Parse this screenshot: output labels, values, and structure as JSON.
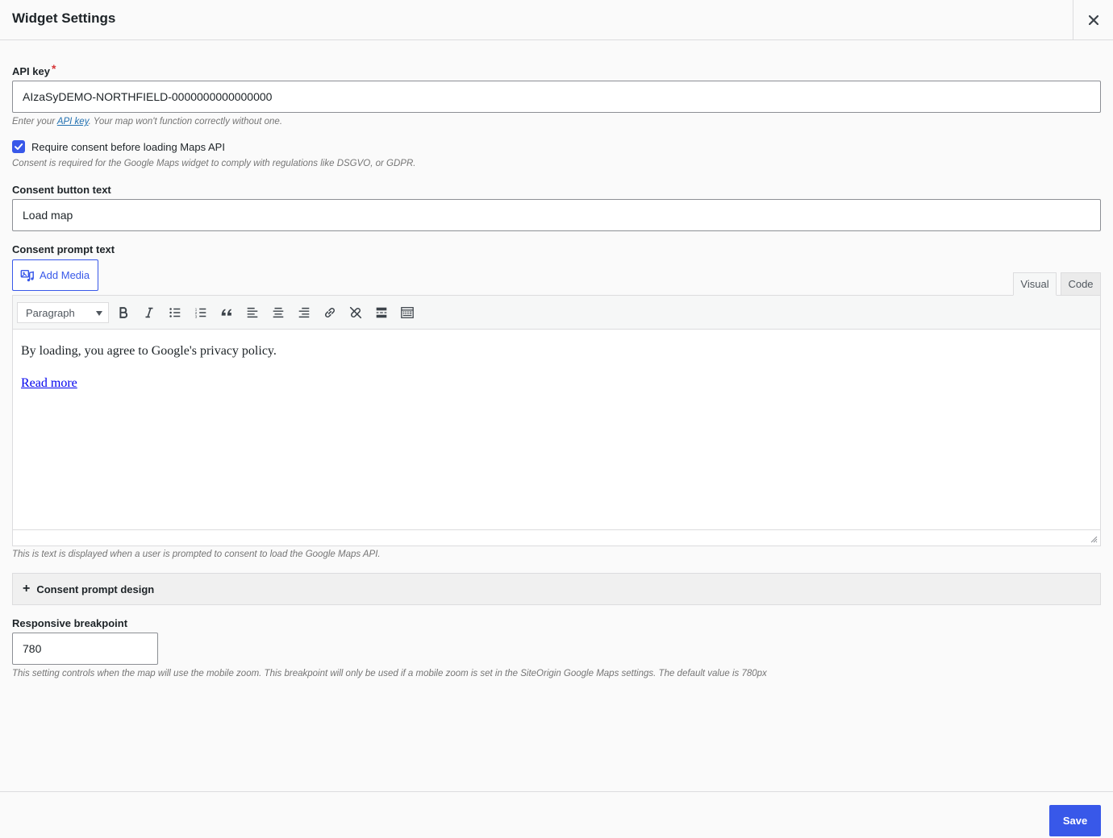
{
  "header": {
    "title": "Widget Settings",
    "close_icon": "close-icon"
  },
  "api_key": {
    "label": "API key",
    "required_mark": "*",
    "value": "AIzaSyDEMO-NORTHFIELD-0000000000000000",
    "desc_prefix": "Enter your ",
    "desc_link": "API key",
    "desc_suffix": ". Your map won't function correctly without one."
  },
  "consent_checkbox": {
    "checked": true,
    "label": "Require consent before loading Maps API",
    "desc": "Consent is required for the Google Maps widget to comply with regulations like DSGVO, or GDPR."
  },
  "consent_button": {
    "label": "Consent button text",
    "value": "Load map"
  },
  "consent_prompt": {
    "label": "Consent prompt text",
    "add_media_label": "Add Media",
    "tabs": [
      {
        "label": "Visual",
        "active": true
      },
      {
        "label": "Code",
        "active": false
      }
    ],
    "format_select": "Paragraph",
    "toolbar_icons": [
      "bold-icon",
      "italic-icon",
      "bullet-list-icon",
      "numbered-list-icon",
      "blockquote-icon",
      "align-left-icon",
      "align-center-icon",
      "align-right-icon",
      "link-icon",
      "unlink-icon",
      "read-more-icon",
      "toolbar-toggle-icon"
    ],
    "content_paragraph": "By loading, you agree to Google's privacy policy.",
    "content_link": "Read more",
    "desc": "This is text is displayed when a user is prompted to consent to load the Google Maps API."
  },
  "design_section": {
    "icon": "+",
    "label": "Consent prompt design"
  },
  "breakpoint": {
    "label": "Responsive breakpoint",
    "value": "780",
    "desc": "This setting controls when the map will use the mobile zoom. This breakpoint will only be used if a mobile zoom is set in the SiteOrigin Google Maps settings. The default value is 780px"
  },
  "footer": {
    "save_label": "Save"
  },
  "colors": {
    "accent": "#3858e9",
    "required": "#d63638"
  }
}
